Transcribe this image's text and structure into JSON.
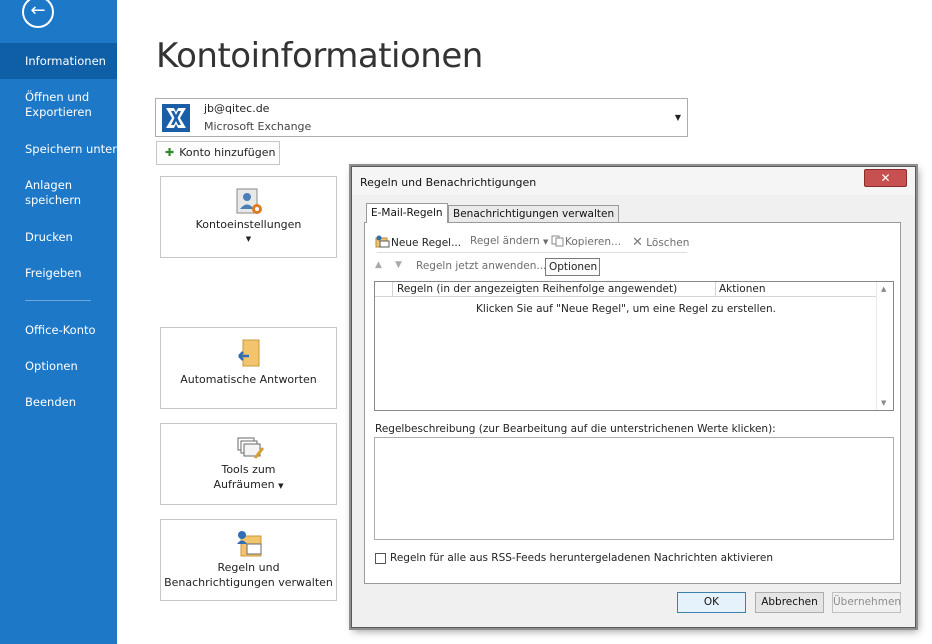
{
  "sidebar": {
    "back_icon": "back-arrow-icon",
    "items": [
      {
        "label": "Informationen",
        "active": true
      },
      {
        "label": "Öffnen und Exportieren"
      },
      {
        "label": "Speichern unter"
      },
      {
        "label": "Anlagen speichern"
      },
      {
        "label": "Drucken"
      },
      {
        "label": "Freigeben"
      },
      {
        "label": "Office-Konto"
      },
      {
        "label": "Optionen"
      },
      {
        "label": "Beenden"
      }
    ]
  },
  "main": {
    "title": "Kontoinformationen",
    "account": {
      "email": "jb@qitec.de",
      "type": "Microsoft Exchange"
    },
    "add_account": "Konto hinzufügen",
    "tiles": {
      "settings": "Kontoeinstellungen",
      "auto_reply": "Automatische Antworten",
      "cleanup_line1": "Tools zum",
      "cleanup_line2": "Aufräumen",
      "rules_line1": "Regeln und",
      "rules_line2": "Benachrichtigungen verwalten"
    }
  },
  "dialog": {
    "title": "Regeln und Benachrichtigungen",
    "tabs": [
      "E-Mail-Regeln",
      "Benachrichtigungen verwalten"
    ],
    "toolbar": {
      "new_rule": "Neue Regel...",
      "change_rule": "Regel ändern",
      "copy": "Kopieren...",
      "delete": "Löschen",
      "apply_now": "Regeln jetzt anwenden...",
      "options": "Optionen"
    },
    "list": {
      "col_rules": "Regeln (in der angezeigten Reihenfolge angewendet)",
      "col_actions": "Aktionen",
      "empty_text": "Klicken Sie auf \"Neue Regel\", um eine Regel zu erstellen."
    },
    "description_label": "Regelbeschreibung (zur Bearbeitung auf die unterstrichenen Werte klicken):",
    "rss_label": "Regeln für alle aus RSS-Feeds heruntergeladenen Nachrichten aktivieren",
    "buttons": {
      "ok": "OK",
      "cancel": "Abbrechen",
      "apply": "Übernehmen"
    }
  },
  "colors": {
    "sidebar": "#1d78c7",
    "sidebar_active": "#0f5fa6",
    "close_button": "#c75050"
  }
}
